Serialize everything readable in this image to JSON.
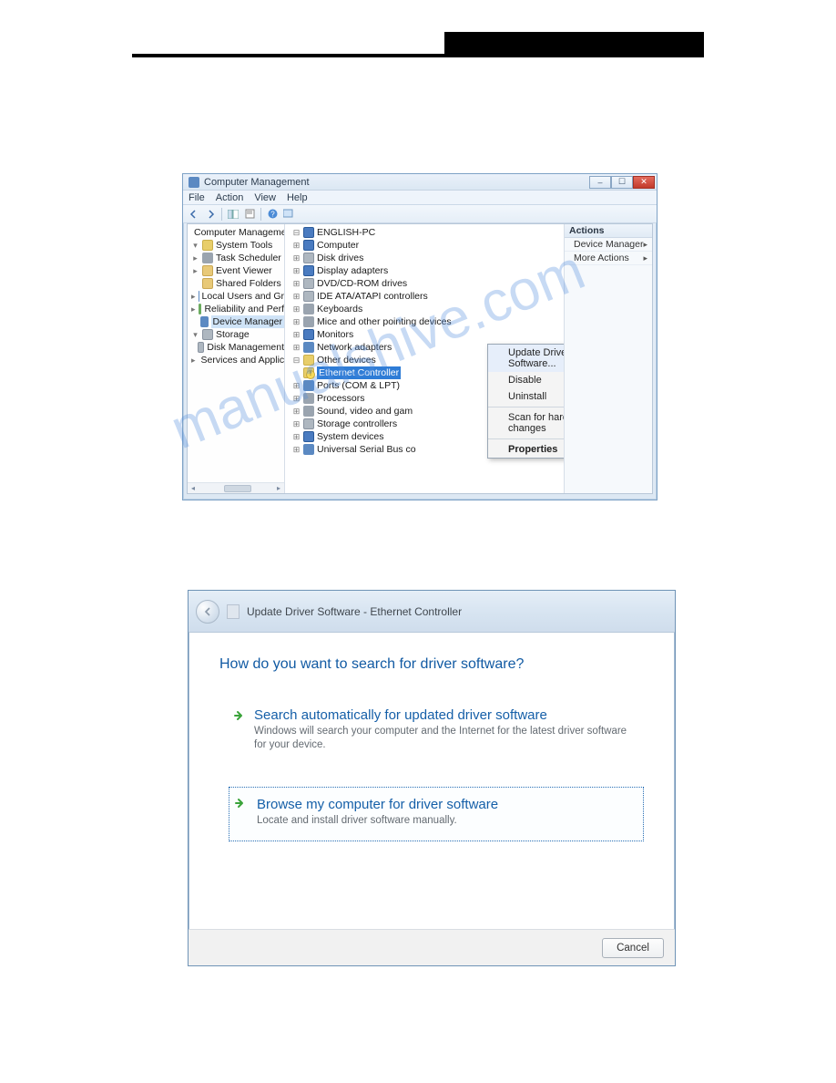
{
  "watermark": "manualshive.com",
  "win1": {
    "title": "Computer Management",
    "menu": [
      "File",
      "Action",
      "View",
      "Help"
    ],
    "left_tree": {
      "root": "Computer Management",
      "groups": [
        {
          "label": "System Tools",
          "children": [
            "Task Scheduler",
            "Event Viewer",
            "Shared Folders",
            "Local Users and Gr",
            "Reliability and Perf",
            "Device Manager"
          ]
        },
        {
          "label": "Storage",
          "children": [
            "Disk Management"
          ]
        },
        {
          "label": "Services and Applicat",
          "children": []
        }
      ],
      "selected": "Device Manager"
    },
    "mid_tree": {
      "root": "ENGLISH-PC",
      "items": [
        "Computer",
        "Disk drives",
        "Display adapters",
        "DVD/CD-ROM drives",
        "IDE ATA/ATAPI controllers",
        "Keyboards",
        "Mice and other pointing devices",
        "Monitors",
        "Network adapters"
      ],
      "other_devices": {
        "label": "Other devices",
        "child": "Ethernet Controller"
      },
      "rest": [
        "Ports (COM & LPT)",
        "Processors",
        "Sound, video and gam",
        "Storage controllers",
        "System devices",
        "Universal Serial Bus co"
      ]
    },
    "context_menu": [
      "Update Driver Software...",
      "Disable",
      "Uninstall",
      "Scan for hardware changes",
      "Properties"
    ],
    "actions": {
      "header": "Actions",
      "rows": [
        "Device Manager",
        "More Actions"
      ]
    }
  },
  "win2": {
    "title": "Update Driver Software -  Ethernet Controller",
    "question": "How do you want to search for driver software?",
    "options": [
      {
        "title": "Search automatically for updated driver software",
        "desc": "Windows will search your computer and the Internet for the latest driver software for your device."
      },
      {
        "title": "Browse my computer for driver software",
        "desc": "Locate and install driver software manually."
      }
    ],
    "cancel": "Cancel"
  }
}
